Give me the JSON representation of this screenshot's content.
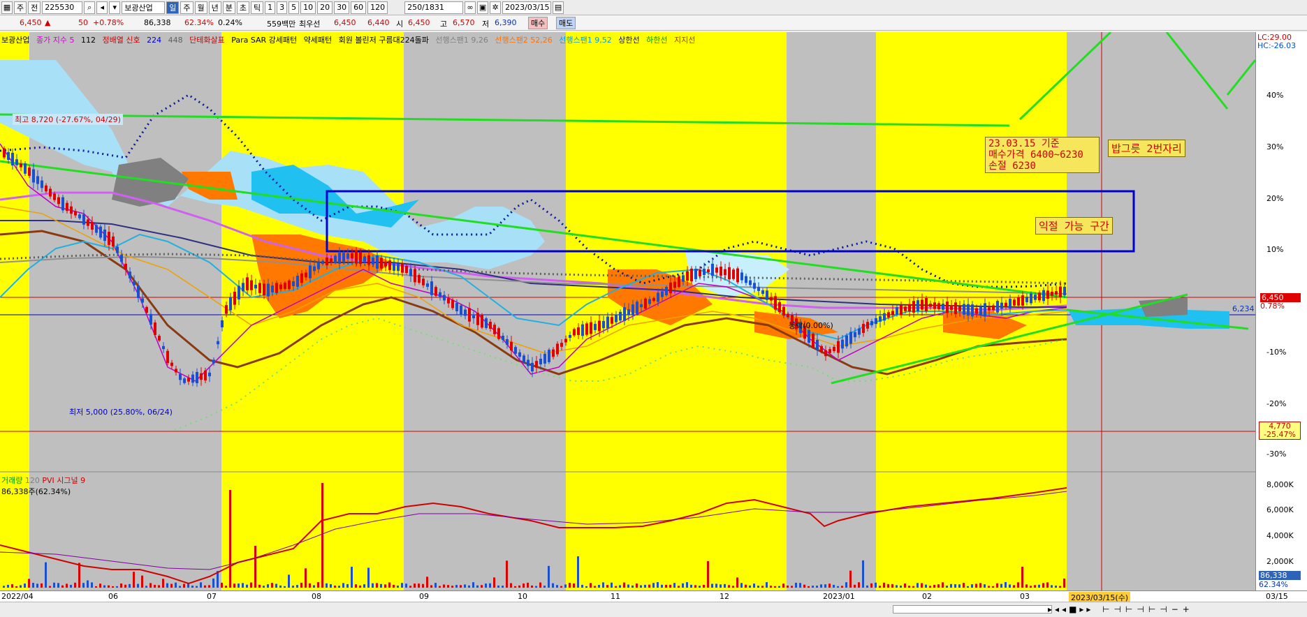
{
  "toolbar": {
    "buttons": [
      "주",
      "전"
    ],
    "code": "225530",
    "stock_name": "보광산업",
    "period_tabs": [
      "일",
      "주",
      "월",
      "년",
      "분",
      "초",
      "틱"
    ],
    "minute_tabs": [
      "1",
      "3",
      "5",
      "10",
      "20",
      "30",
      "60",
      "120"
    ],
    "count": "250/1831",
    "date": "2023/03/15"
  },
  "pricebar": {
    "price": "6,450",
    "change_arrow": "▲",
    "change": "50",
    "change_pct": "+0.78%",
    "volume": "86,338",
    "vol_ratio": "62.34%",
    "turnover": "0.24%",
    "amount": "559백만",
    "pref_label": "최우선",
    "ask": "6,450",
    "bid": "6,440",
    "open_label": "시",
    "open": "6,450",
    "high_label": "고",
    "high": "6,570",
    "low_label": "저",
    "low": "6,390",
    "buy_button": "매수",
    "sell_button": "매도"
  },
  "legend": {
    "name": "보광산업",
    "ma": "종가 지수 5",
    "ma_periods": [
      "112"
    ],
    "ma_signal": "정배열 신호",
    "ma_periods2": [
      "224",
      "448"
    ],
    "sub1": "단테화살표",
    "sub2": "Para SAR 강세패턴",
    "sub3": "약세패턴",
    "sub4": "회원 볼린저 구름대224돌파",
    "ichimoku": [
      "선행스팬1 9,26",
      "선행스팬2 52,26",
      "선행스팬1 9,52"
    ],
    "bands": [
      "상한선",
      "하한선",
      "지지선"
    ]
  },
  "labels": {
    "high_mark": "최고 8,720 (-27.67%, 04/29)",
    "low_mark": "최저 5,000 (25.80%, 06/24)",
    "change_mark": "등락(0.00%)"
  },
  "annotations": {
    "box1_line1": "23.03.15 기준",
    "box1_line2": "매수가격 6400~6230",
    "box1_line3": "손절 6230",
    "box2": "밥그릇 2번자리",
    "box3": "익절 가능 구간"
  },
  "yaxis": {
    "lc": "LC:29.00",
    "hc": "HC:-26.03",
    "ticks": [
      "40%",
      "30%",
      "20%",
      "10%",
      "0.78%",
      "-10%",
      "-20%",
      "-30%"
    ],
    "price_tag": "6,450",
    "support_tag": "6,234",
    "low_tag_line1": "4,770",
    "low_tag_line2": "-25.47%",
    "vol_ticks": [
      "8,000K",
      "6,000K",
      "4,000K",
      "2,000K"
    ],
    "vol_tag": "86,338",
    "vol_pct": "62.34%"
  },
  "volume_legend": {
    "label": "거래량",
    "period": "120",
    "pvi": "PVI",
    "signal": "시그널 9",
    "value": "86,338주(62.34%)"
  },
  "xaxis": {
    "labels": [
      "2022/04",
      "06",
      "07",
      "08",
      "09",
      "10",
      "11",
      "12",
      "2023/01",
      "02",
      "03"
    ],
    "current": "2023/03/15(수)",
    "right": "03/15"
  },
  "colors": {
    "highlight": "#ffff00",
    "background": "#bfbfbf",
    "up": "#e00000",
    "down": "#1a4fd0",
    "trend": "#22dd22",
    "box": "#0000cc"
  }
}
